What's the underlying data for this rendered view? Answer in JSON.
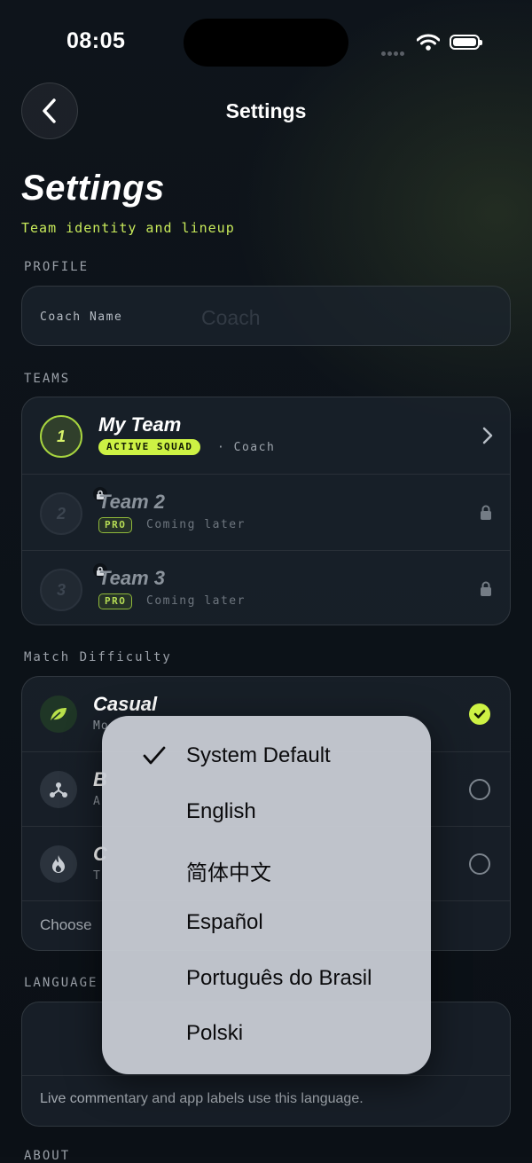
{
  "status_bar": {
    "time": "08:05"
  },
  "header": {
    "nav_title": "Settings",
    "title": "Settings",
    "subtitle": "Team identity and lineup"
  },
  "profile": {
    "section_label": "PROFILE",
    "coach_name_label": "Coach Name",
    "coach_name_placeholder": "Coach",
    "coach_name_value": ""
  },
  "teams": {
    "section_label": "TEAMS",
    "items": [
      {
        "number": "1",
        "name": "My Team",
        "badge": "ACTIVE SQUAD",
        "meta": "· Coach",
        "state": "active"
      },
      {
        "number": "2",
        "name": "Team 2",
        "badge": "PRO",
        "meta": "Coming later",
        "state": "locked"
      },
      {
        "number": "3",
        "name": "Team 3",
        "badge": "PRO",
        "meta": "Coming later",
        "state": "locked"
      }
    ]
  },
  "difficulty": {
    "section_label": "Match Difficulty",
    "items": [
      {
        "name": "Casual",
        "desc": "Mo",
        "selected": true,
        "icon": "leaf-icon"
      },
      {
        "name": "B",
        "desc": "A",
        "selected": false,
        "icon": "network-icon"
      },
      {
        "name": "C",
        "desc": "T",
        "selected": false,
        "icon": "flame-icon"
      }
    ],
    "note": "Choose"
  },
  "language": {
    "section_label": "LANGUAGE",
    "note": "Live commentary and app labels use this language.",
    "menu_options": [
      "System Default",
      "English",
      "简体中文",
      "Español",
      "Português do Brasil",
      "Polski"
    ],
    "selected_option": "System Default"
  },
  "colors": {
    "accent": "#cdf244",
    "background": "#0c1117"
  }
}
